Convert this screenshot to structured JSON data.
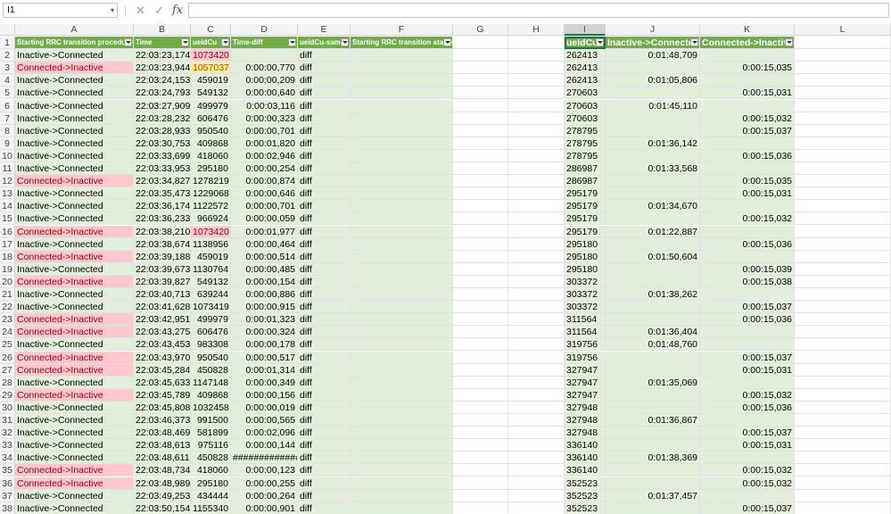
{
  "formula_bar": {
    "name_box": "I1",
    "cancel_icon": "✕",
    "enter_icon": "✓",
    "fx_icon": "fx",
    "formula": ""
  },
  "columns": [
    "A",
    "B",
    "C",
    "D",
    "E",
    "F",
    "G",
    "H",
    "I",
    "J",
    "K",
    "L"
  ],
  "headers": {
    "a": "Starting RRC transition procedure",
    "b": "Time",
    "c": "ueIdCu",
    "d": "Time-diff",
    "e": "ueIdCu-same",
    "f": "Starting RRC transition status",
    "i": "ueIdCu",
    "j": "Inactive->Connected",
    "k": "Connected->Inactive"
  },
  "colors": {
    "table_header": "#70ad47",
    "band": "#e2efda",
    "bad_fill": "#ffc7ce",
    "bad_text": "#9c0006",
    "neutral_fill": "#ffeb9c",
    "selection": "#217346"
  },
  "rows": [
    {
      "n": "2",
      "a": "Inactive->Connected",
      "b": "22:03:23,174",
      "c": "1073420",
      "d": "",
      "e": "diff",
      "i": "262413",
      "j": "0:01:48,709",
      "k": "",
      "af": "n",
      "cf": "p"
    },
    {
      "n": "3",
      "a": "Connected->Inactive",
      "b": "22:03:23,944",
      "c": "1057037",
      "d": "0:00:00,770",
      "e": "diff",
      "i": "262413",
      "j": "",
      "k": "0:00:15,035",
      "af": "p",
      "cf": "y"
    },
    {
      "n": "4",
      "a": "Inactive->Connected",
      "b": "22:03:24,153",
      "c": "459019",
      "d": "0:00:00,209",
      "e": "diff",
      "i": "262413",
      "j": "0:01:05,806",
      "k": "",
      "af": "n",
      "cf": "n"
    },
    {
      "n": "5",
      "a": "Inactive->Connected",
      "b": "22:03:24,793",
      "c": "549132",
      "d": "0:00:00,640",
      "e": "diff",
      "i": "270603",
      "j": "",
      "k": "0:00:15,031",
      "af": "n",
      "cf": "n"
    },
    {
      "n": "6",
      "a": "Inactive->Connected",
      "b": "22:03:27,909",
      "c": "499979",
      "d": "0:00:03,116",
      "e": "diff",
      "i": "270603",
      "j": "0:01:45,110",
      "k": "",
      "af": "n",
      "cf": "n"
    },
    {
      "n": "7",
      "a": "Inactive->Connected",
      "b": "22:03:28,232",
      "c": "606476",
      "d": "0:00:00,323",
      "e": "diff",
      "i": "270603",
      "j": "",
      "k": "0:00:15,032",
      "af": "n",
      "cf": "n"
    },
    {
      "n": "8",
      "a": "Inactive->Connected",
      "b": "22:03:28,933",
      "c": "950540",
      "d": "0:00:00,701",
      "e": "diff",
      "i": "278795",
      "j": "",
      "k": "0:00:15,037",
      "af": "n",
      "cf": "n"
    },
    {
      "n": "9",
      "a": "Inactive->Connected",
      "b": "22:03:30,753",
      "c": "409868",
      "d": "0:00:01,820",
      "e": "diff",
      "i": "278795",
      "j": "0:01:36,142",
      "k": "",
      "af": "n",
      "cf": "n"
    },
    {
      "n": "10",
      "a": "Inactive->Connected",
      "b": "22:03:33,699",
      "c": "418060",
      "d": "0:00:02,946",
      "e": "diff",
      "i": "278795",
      "j": "",
      "k": "0:00:15,036",
      "af": "n",
      "cf": "n"
    },
    {
      "n": "11",
      "a": "Inactive->Connected",
      "b": "22:03:33,953",
      "c": "295180",
      "d": "0:00:00,254",
      "e": "diff",
      "i": "286987",
      "j": "0:01:33,568",
      "k": "",
      "af": "n",
      "cf": "n"
    },
    {
      "n": "12",
      "a": "Connected->Inactive",
      "b": "22:03:34,827",
      "c": "1278219",
      "d": "0:00:00,874",
      "e": "diff",
      "i": "286987",
      "j": "",
      "k": "0:00:15,035",
      "af": "p",
      "cf": "n"
    },
    {
      "n": "13",
      "a": "Inactive->Connected",
      "b": "22:03:35,473",
      "c": "1229068",
      "d": "0:00:00,646",
      "e": "diff",
      "i": "295179",
      "j": "",
      "k": "0:00:15,031",
      "af": "n",
      "cf": "n"
    },
    {
      "n": "14",
      "a": "Inactive->Connected",
      "b": "22:03:36,174",
      "c": "1122572",
      "d": "0:00:00,701",
      "e": "diff",
      "i": "295179",
      "j": "0:01:34,670",
      "k": "",
      "af": "n",
      "cf": "n"
    },
    {
      "n": "15",
      "a": "Inactive->Connected",
      "b": "22:03:36,233",
      "c": "966924",
      "d": "0:00:00,059",
      "e": "diff",
      "i": "295179",
      "j": "",
      "k": "0:00:15,032",
      "af": "n",
      "cf": "n"
    },
    {
      "n": "16",
      "a": "Connected->Inactive",
      "b": "22:03:38,210",
      "c": "1073420",
      "d": "0:00:01,977",
      "e": "diff",
      "i": "295179",
      "j": "0:01:22,887",
      "k": "",
      "af": "p",
      "cf": "p"
    },
    {
      "n": "17",
      "a": "Inactive->Connected",
      "b": "22:03:38,674",
      "c": "1138956",
      "d": "0:00:00,464",
      "e": "diff",
      "i": "295180",
      "j": "",
      "k": "0:00:15,036",
      "af": "n",
      "cf": "n"
    },
    {
      "n": "18",
      "a": "Connected->Inactive",
      "b": "22:03:39,188",
      "c": "459019",
      "d": "0:00:00,514",
      "e": "diff",
      "i": "295180",
      "j": "0:01:50,604",
      "k": "",
      "af": "p",
      "cf": "n"
    },
    {
      "n": "19",
      "a": "Inactive->Connected",
      "b": "22:03:39,673",
      "c": "1130764",
      "d": "0:00:00,485",
      "e": "diff",
      "i": "295180",
      "j": "",
      "k": "0:00:15,039",
      "af": "n",
      "cf": "n"
    },
    {
      "n": "20",
      "a": "Connected->Inactive",
      "b": "22:03:39,827",
      "c": "549132",
      "d": "0:00:00,154",
      "e": "diff",
      "i": "303372",
      "j": "",
      "k": "0:00:15,038",
      "af": "p",
      "cf": "n"
    },
    {
      "n": "21",
      "a": "Inactive->Connected",
      "b": "22:03:40,713",
      "c": "639244",
      "d": "0:00:00,886",
      "e": "diff",
      "i": "303372",
      "j": "0:01:38,262",
      "k": "",
      "af": "n",
      "cf": "n"
    },
    {
      "n": "22",
      "a": "Inactive->Connected",
      "b": "22:03:41,628",
      "c": "1073419",
      "d": "0:00:00,915",
      "e": "diff",
      "i": "303372",
      "j": "",
      "k": "0:00:15,037",
      "af": "n",
      "cf": "n"
    },
    {
      "n": "23",
      "a": "Connected->Inactive",
      "b": "22:03:42,951",
      "c": "499979",
      "d": "0:00:01,323",
      "e": "diff",
      "i": "311564",
      "j": "",
      "k": "0:00:15,036",
      "af": "p",
      "cf": "n"
    },
    {
      "n": "24",
      "a": "Connected->Inactive",
      "b": "22:03:43,275",
      "c": "606476",
      "d": "0:00:00,324",
      "e": "diff",
      "i": "311564",
      "j": "0:01:36,404",
      "k": "",
      "af": "p",
      "cf": "n"
    },
    {
      "n": "25",
      "a": "Inactive->Connected",
      "b": "22:03:43,453",
      "c": "983308",
      "d": "0:00:00,178",
      "e": "diff",
      "i": "319756",
      "j": "0:01:48,760",
      "k": "",
      "af": "n",
      "cf": "n"
    },
    {
      "n": "26",
      "a": "Connected->Inactive",
      "b": "22:03:43,970",
      "c": "950540",
      "d": "0:00:00,517",
      "e": "diff",
      "i": "319756",
      "j": "",
      "k": "0:00:15,037",
      "af": "p",
      "cf": "n"
    },
    {
      "n": "27",
      "a": "Connected->Inactive",
      "b": "22:03:45,284",
      "c": "450828",
      "d": "0:00:01,314",
      "e": "diff",
      "i": "327947",
      "j": "",
      "k": "0:00:15,031",
      "af": "p",
      "cf": "n"
    },
    {
      "n": "28",
      "a": "Inactive->Connected",
      "b": "22:03:45,633",
      "c": "1147148",
      "d": "0:00:00,349",
      "e": "diff",
      "i": "327947",
      "j": "0:01:35,069",
      "k": "",
      "af": "n",
      "cf": "n"
    },
    {
      "n": "29",
      "a": "Connected->Inactive",
      "b": "22:03:45,789",
      "c": "409868",
      "d": "0:00:00,156",
      "e": "diff",
      "i": "327947",
      "j": "",
      "k": "0:00:15,032",
      "af": "p",
      "cf": "n"
    },
    {
      "n": "30",
      "a": "Inactive->Connected",
      "b": "22:03:45,808",
      "c": "1032458",
      "d": "0:00:00,019",
      "e": "diff",
      "i": "327948",
      "j": "",
      "k": "0:00:15,036",
      "af": "n",
      "cf": "n"
    },
    {
      "n": "31",
      "a": "Inactive->Connected",
      "b": "22:03:46,373",
      "c": "991500",
      "d": "0:00:00,565",
      "e": "diff",
      "i": "327948",
      "j": "0:01:36,867",
      "k": "",
      "af": "n",
      "cf": "n"
    },
    {
      "n": "32",
      "a": "Inactive->Connected",
      "b": "22:03:48,469",
      "c": "581899",
      "d": "0:00:02,096",
      "e": "diff",
      "i": "327948",
      "j": "",
      "k": "0:00:15,037",
      "af": "n",
      "cf": "n"
    },
    {
      "n": "33",
      "a": "Inactive->Connected",
      "b": "22:03:48,613",
      "c": "975116",
      "d": "0:00:00,144",
      "e": "diff",
      "i": "336140",
      "j": "",
      "k": "0:00:15,031",
      "af": "n",
      "cf": "n"
    },
    {
      "n": "34",
      "a": "Inactive->Connected",
      "b": "22:03:48,611",
      "c": "450828",
      "d": "##############",
      "e": "diff",
      "i": "336140",
      "j": "0:01:38,369",
      "k": "",
      "af": "n",
      "cf": "n"
    },
    {
      "n": "35",
      "a": "Connected->Inactive",
      "b": "22:03:48,734",
      "c": "418060",
      "d": "0:00:00,123",
      "e": "diff",
      "i": "336140",
      "j": "",
      "k": "0:00:15,032",
      "af": "p",
      "cf": "n"
    },
    {
      "n": "36",
      "a": "Connected->Inactive",
      "b": "22:03:48,989",
      "c": "295180",
      "d": "0:00:00,255",
      "e": "diff",
      "i": "352523",
      "j": "",
      "k": "0:00:15,032",
      "af": "p",
      "cf": "n"
    },
    {
      "n": "37",
      "a": "Inactive->Connected",
      "b": "22:03:49,253",
      "c": "434444",
      "d": "0:00:00,264",
      "e": "diff",
      "i": "352523",
      "j": "0:01:37,457",
      "k": "",
      "af": "n",
      "cf": "n"
    },
    {
      "n": "38",
      "a": "Inactive->Connected",
      "b": "22:03:50,154",
      "c": "1155340",
      "d": "0:00:00,901",
      "e": "diff",
      "i": "352523",
      "j": "",
      "k": "0:00:15,037",
      "af": "n",
      "cf": "n"
    }
  ]
}
